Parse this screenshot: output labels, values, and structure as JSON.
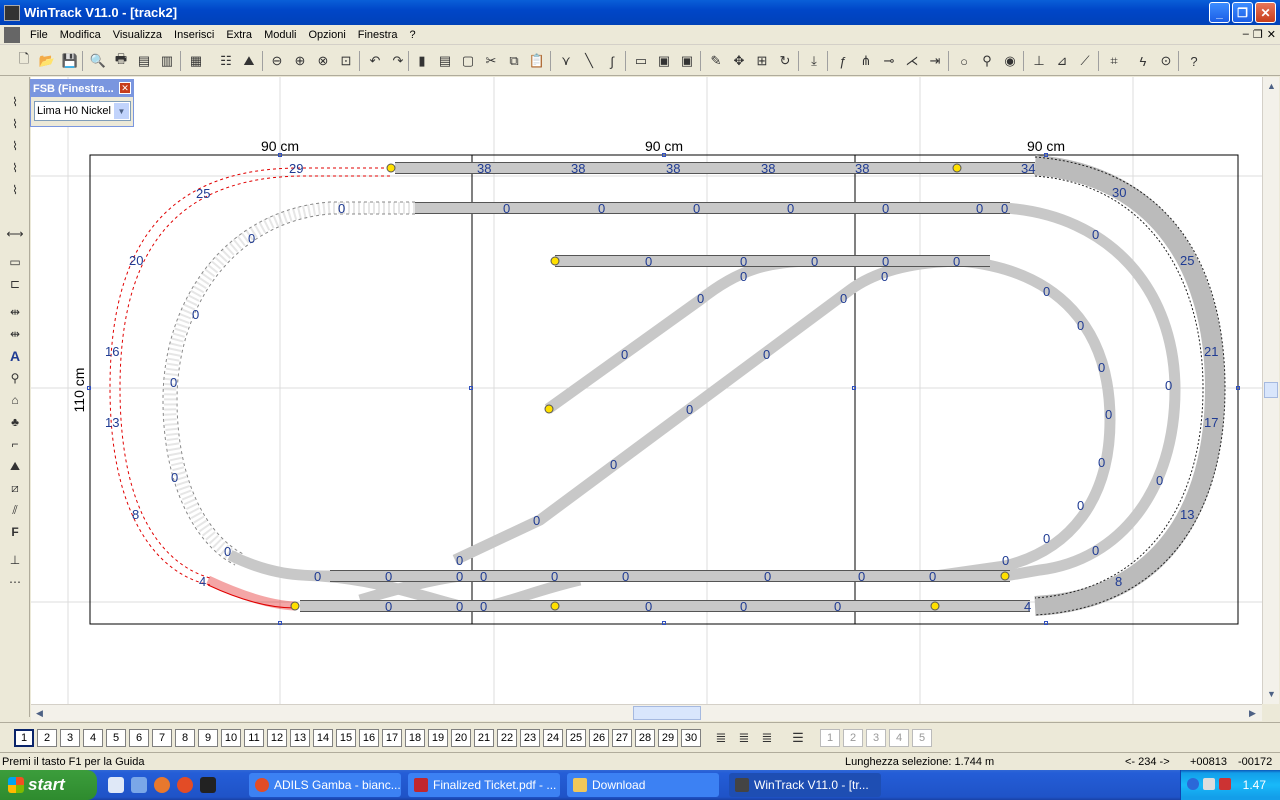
{
  "window": {
    "title": "WinTrack  V11.0 - [track2]"
  },
  "menu": {
    "items": [
      "File",
      "Modifica",
      "Visualizza",
      "Inserisci",
      "Extra",
      "Moduli",
      "Opzioni",
      "Finestra",
      "?"
    ]
  },
  "fsb": {
    "title": "FSB (Finestra...",
    "selected": "Lima H0 Nickel"
  },
  "drawing": {
    "dim_top": [
      "90 cm",
      "90 cm",
      "90 cm"
    ],
    "dim_left": "110 cm",
    "outer_labels": [
      "29",
      "25",
      "20",
      "16",
      "13",
      "8",
      "4"
    ],
    "inner_left_labels": [
      "0",
      "0",
      "0",
      "0",
      "0"
    ],
    "outer_right_labels": [
      "30",
      "25",
      "21",
      "17",
      "13",
      "8",
      "4",
      "34"
    ],
    "top_row_labels": [
      "38",
      "38",
      "38",
      "38",
      "38"
    ],
    "zero": "0"
  },
  "layers": [
    "1",
    "2",
    "3",
    "4",
    "5",
    "6",
    "7",
    "8",
    "9",
    "10",
    "11",
    "12",
    "13",
    "14",
    "15",
    "16",
    "17",
    "18",
    "19",
    "20",
    "21",
    "22",
    "23",
    "24",
    "25",
    "26",
    "27",
    "28",
    "29",
    "30"
  ],
  "extra_layers": [
    "1",
    "2",
    "3",
    "4",
    "5"
  ],
  "status": {
    "help": "Premi il tasto F1 per la Guida",
    "selection": "Lunghezza selezione:  1.744 m",
    "nav": "<- 234 ->",
    "x": "+00813",
    "y": "-00172"
  },
  "taskbar": {
    "start": "start",
    "tasks": [
      "ADILS Gamba - bianc...",
      "Finalized Ticket.pdf - ...",
      "Download",
      "WinTrack  V11.0 - [tr..."
    ],
    "clock": "1.47"
  },
  "colors": {
    "titlebar": "#0046c8",
    "track": "#c8c8c8",
    "selected": "#e00000",
    "label": "#1f3b93"
  }
}
